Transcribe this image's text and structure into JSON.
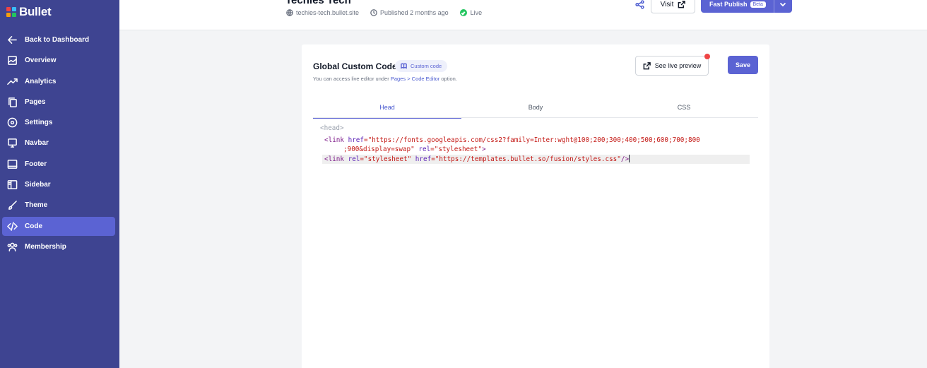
{
  "brand": {
    "name": "Bullet",
    "logo_colors": [
      "#ef4444",
      "#38bdf8",
      "#f59e0b",
      "#22c55e"
    ]
  },
  "sidebar": {
    "items": [
      {
        "label": "Back to Dashboard",
        "icon": "arrow-left-icon"
      },
      {
        "label": "Overview",
        "icon": "image-icon"
      },
      {
        "label": "Analytics",
        "icon": "trend-icon"
      },
      {
        "label": "Pages",
        "icon": "pages-icon"
      },
      {
        "label": "Settings",
        "icon": "settings-icon"
      },
      {
        "label": "Navbar",
        "icon": "navbar-icon"
      },
      {
        "label": "Footer",
        "icon": "footer-icon"
      },
      {
        "label": "Sidebar",
        "icon": "sidebar-icon"
      },
      {
        "label": "Theme",
        "icon": "brush-icon"
      },
      {
        "label": "Code",
        "icon": "code-icon",
        "active": true
      },
      {
        "label": "Membership",
        "icon": "users-icon"
      }
    ]
  },
  "header": {
    "site_title": "Techies Tech",
    "domain": "techies-tech.bullet.site",
    "published": "Published 2 months ago",
    "status": "Live",
    "visit_label": "Visit",
    "publish_label": "Fast Publish",
    "beta_label": "Beta"
  },
  "card": {
    "title": "Global Custom Code",
    "tag": "Custom code",
    "subtitle_prefix": "You can access live editor under",
    "subtitle_link_pages": "Pages",
    "subtitle_sep": ">",
    "subtitle_link_editor": "Code Editor",
    "subtitle_suffix": "option.",
    "preview_label": "See live preview",
    "save_label": "Save",
    "tabs": [
      "Head",
      "Body",
      "CSS"
    ],
    "active_tab": "Head"
  },
  "editor": {
    "placeholder": "<head>",
    "line1": {
      "open": "<link",
      "attr1": "href",
      "eq1": "=",
      "val1": "\"https://fonts.googleapis.com/css2?family=Inter:wght@100;200;300;400;500;600;700;800",
      "val1b": ";900&display=swap\"",
      "attr2": "rel",
      "eq2": "=",
      "val2": "\"stylesheet\"",
      "close": ">"
    },
    "line2": {
      "open": "<link",
      "attr1": "rel",
      "eq1": "=",
      "val1": "\"stylesheet\"",
      "attr2": "href",
      "eq2": "=",
      "val2": "\"https://templates.bullet.so/fusion/styles.css\"",
      "close": "/>"
    }
  }
}
